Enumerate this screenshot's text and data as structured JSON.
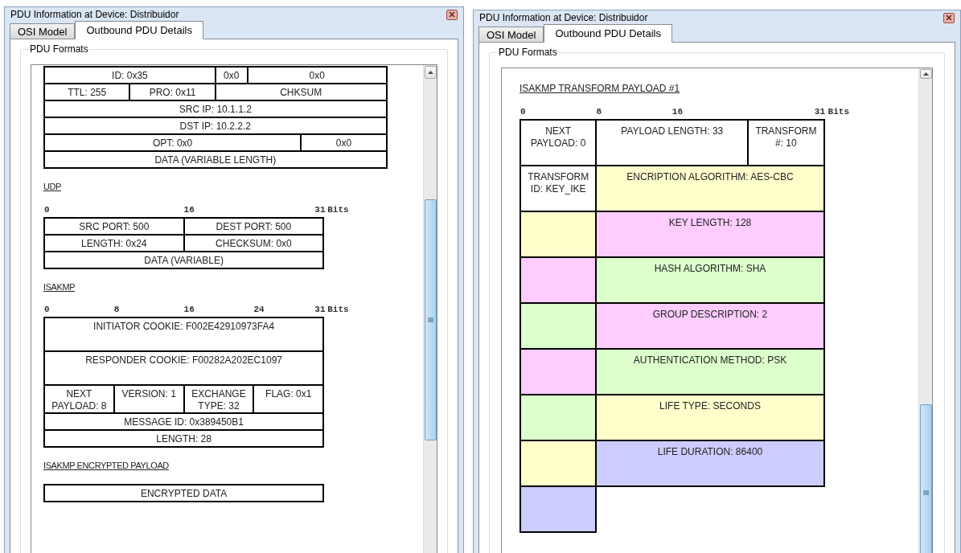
{
  "windows": [
    {
      "title": "PDU Information at Device: Distribuidor",
      "tabs": [
        {
          "label": "OSI Model",
          "selected": false
        },
        {
          "label": "Outbound PDU Details",
          "selected": true
        }
      ],
      "group_label": "PDU Formats",
      "sections": [
        {
          "kind": "wide",
          "words": [
            [
              {
                "text": "ID: 0x35",
                "kind": "half"
              },
              {
                "text": "0x0",
                "kind": "flags"
              },
              {
                "text": "0x0",
                "kind": "offset"
              }
            ],
            [
              {
                "text": "TTL: 255",
                "kind": "byte"
              },
              {
                "text": "PRO: 0x11",
                "kind": "byte"
              },
              {
                "text": "CHKSUM",
                "kind": "half"
              }
            ],
            [
              {
                "text": "SRC IP: 10.1.1.2",
                "kind": "word"
              }
            ],
            [
              {
                "text": "DST IP: 10.2.2.2",
                "kind": "word"
              }
            ],
            [
              {
                "text": "OPT: 0x0",
                "kind": "triple"
              },
              {
                "text": "0x0",
                "kind": "byte"
              }
            ],
            [
              {
                "text": "DATA (VARIABLE LENGTH)",
                "kind": "word"
              }
            ]
          ]
        },
        {
          "kind": "narrow",
          "heading": "UDP",
          "ruler": [
            "0",
            "16",
            "31"
          ],
          "ruler_unit": "Bits",
          "words": [
            [
              {
                "text": "SRC PORT: 500",
                "kind": "half"
              },
              {
                "text": "DEST PORT: 500",
                "kind": "half"
              }
            ],
            [
              {
                "text": "LENGTH: 0x24",
                "kind": "half"
              },
              {
                "text": "CHECKSUM: 0x0",
                "kind": "half"
              }
            ],
            [
              {
                "text": "DATA (VARIABLE)",
                "kind": "word"
              }
            ]
          ]
        },
        {
          "kind": "narrow",
          "heading": "ISAKMP",
          "ruler": [
            "0",
            "8",
            "16",
            "24",
            "31"
          ],
          "ruler_unit": "Bits",
          "words": [
            [
              {
                "text": "INITIATOR COOKIE: F002E42910973FA4",
                "kind": "long"
              }
            ],
            [
              {
                "text": "RESPONDER COOKIE: F00282A202EC1097",
                "kind": "long"
              }
            ],
            [
              {
                "text": "NEXT PAYLOAD: 8",
                "kind": "byte"
              },
              {
                "text": "VERSION: 1",
                "kind": "byte"
              },
              {
                "text": "EXCHANGE TYPE: 32",
                "kind": "byte"
              },
              {
                "text": "FLAG: 0x1",
                "kind": "byte"
              }
            ],
            [
              {
                "text": "MESSAGE ID: 0x389450B1",
                "kind": "word"
              }
            ],
            [
              {
                "text": "LENGTH: 28",
                "kind": "word"
              }
            ]
          ]
        },
        {
          "kind": "narrow",
          "heading": "ISAKMP ENCRYPTED PAYLOAD",
          "words": [
            [
              {
                "text": "ENCRYPTED DATA",
                "kind": "word"
              }
            ]
          ]
        }
      ]
    },
    {
      "title": "PDU Information at Device: Distribuidor",
      "tabs": [
        {
          "label": "OSI Model",
          "selected": false
        },
        {
          "label": "Outbound PDU Details",
          "selected": true
        }
      ],
      "group_label": "PDU Formats",
      "sections": [
        {
          "kind": "tall",
          "heading": "ISAKMP TRANSFORM PAYLOAD #1",
          "ruler": [
            "0",
            "8",
            "16",
            "31"
          ],
          "ruler_unit": "Bits",
          "words": [
            [
              {
                "text": "NEXT PAYLOAD: 0",
                "kind": "byte"
              },
              {
                "text": "PAYLOAD LENGTH: 33",
                "kind": "half"
              },
              {
                "text": "TRANSFORM #: 10",
                "kind": "byte"
              }
            ],
            [
              {
                "text": "TRANSFORM ID: KEY_IKE",
                "kind": "byte"
              },
              {
                "text": "ENCRIPTION ALGORITHM: AES-CBC",
                "kind": "triple",
                "color": "#ffffcc"
              }
            ],
            [
              {
                "kind": "byte",
                "color": "#ffffcc"
              },
              {
                "text": "KEY LENGTH: 128",
                "kind": "triple",
                "color": "#ffccff"
              }
            ],
            [
              {
                "kind": "byte",
                "color": "#ffccff"
              },
              {
                "text": "HASH ALGORITHM: SHA",
                "kind": "triple",
                "color": "#ddffcc"
              }
            ],
            [
              {
                "kind": "byte",
                "color": "#ddffcc"
              },
              {
                "text": "GROUP DESCRIPTION: 2",
                "kind": "triple",
                "color": "#ffccff"
              }
            ],
            [
              {
                "kind": "byte",
                "color": "#ffccff"
              },
              {
                "text": "AUTHENTICATION METHOD: PSK",
                "kind": "triple",
                "color": "#ddffcc"
              }
            ],
            [
              {
                "kind": "byte",
                "color": "#ddffcc"
              },
              {
                "text": "LIFE TYPE: SECONDS",
                "kind": "triple",
                "color": "#ffffcc"
              }
            ],
            [
              {
                "kind": "byte",
                "color": "#ffffcc"
              },
              {
                "text": "LIFE DURATION: 86400",
                "kind": "triple",
                "color": "#ccccff"
              }
            ],
            [
              {
                "kind": "byte",
                "color": "#ccccff"
              }
            ]
          ]
        }
      ]
    }
  ]
}
